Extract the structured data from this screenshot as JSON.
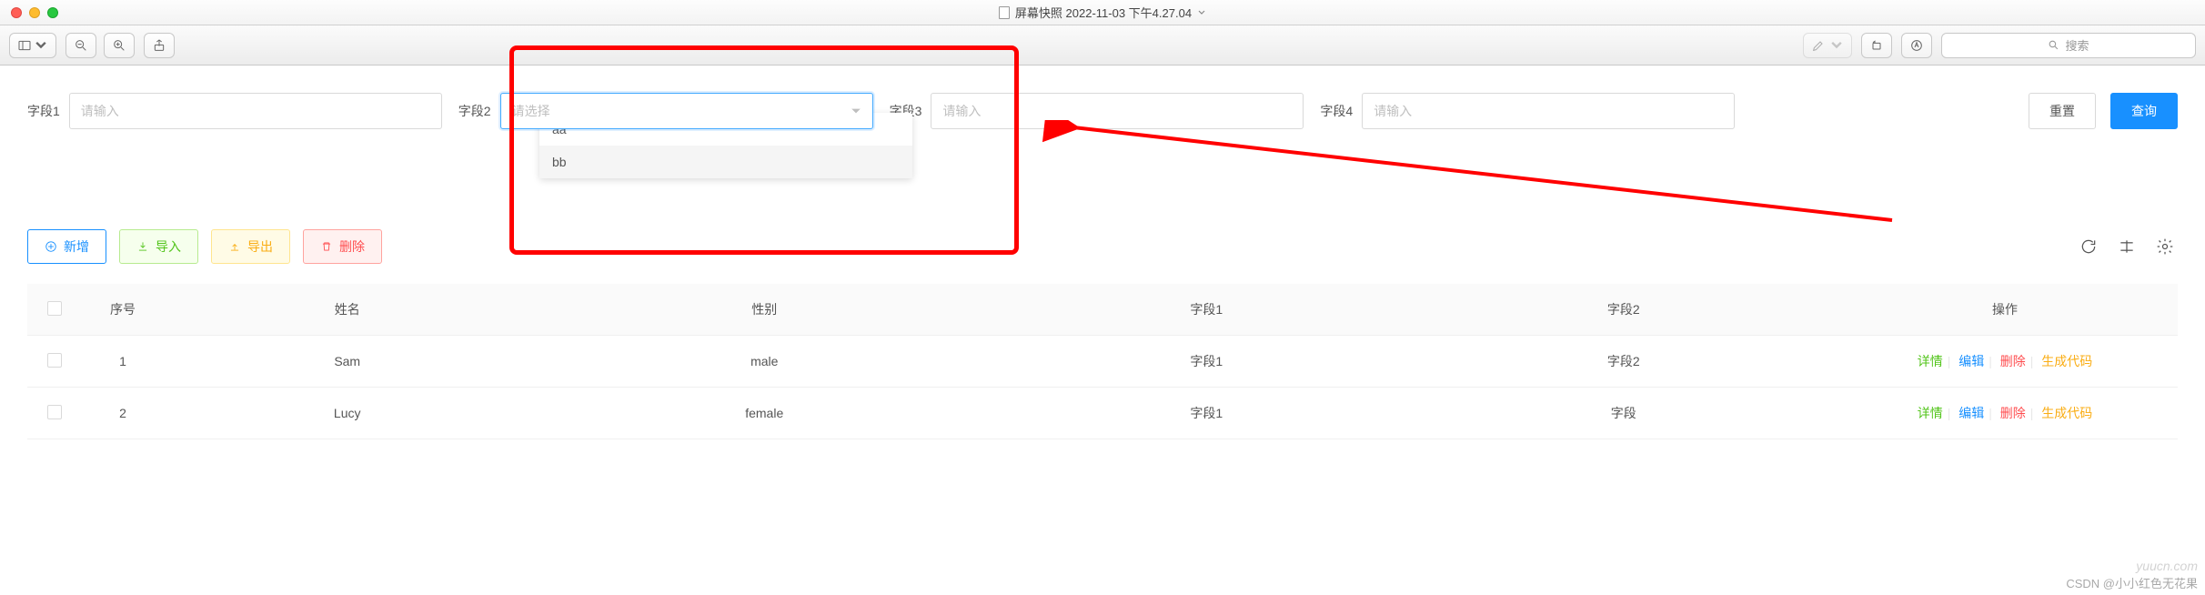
{
  "window": {
    "title": "屏幕快照 2022-11-03 下午4.27.04"
  },
  "toolbar": {
    "search_placeholder": "搜索"
  },
  "filters": {
    "f1": {
      "label": "字段1",
      "placeholder": "请输入"
    },
    "f2": {
      "label": "字段2",
      "placeholder": "请选择",
      "options": [
        "aa",
        "bb"
      ]
    },
    "f3": {
      "label": "字段3",
      "placeholder": "请输入"
    },
    "f4": {
      "label": "字段4",
      "placeholder": "请输入"
    },
    "reset": "重置",
    "query": "查询"
  },
  "actions": {
    "add": "新增",
    "import": "导入",
    "export": "导出",
    "delete": "删除"
  },
  "table": {
    "headers": {
      "index": "序号",
      "name": "姓名",
      "gender": "性别",
      "f1": "字段1",
      "f2": "字段2",
      "ops": "操作"
    },
    "rows": [
      {
        "index": "1",
        "name": "Sam",
        "gender": "male",
        "f1": "字段1",
        "f2": "字段2"
      },
      {
        "index": "2",
        "name": "Lucy",
        "gender": "female",
        "f1": "字段1",
        "f2": "字段"
      }
    ],
    "ops": {
      "detail": "详情",
      "edit": "编辑",
      "delete": "删除",
      "gen": "生成代码"
    }
  },
  "watermark": {
    "url": "yuucn.com",
    "csdn": "CSDN @小小红色无花果"
  }
}
